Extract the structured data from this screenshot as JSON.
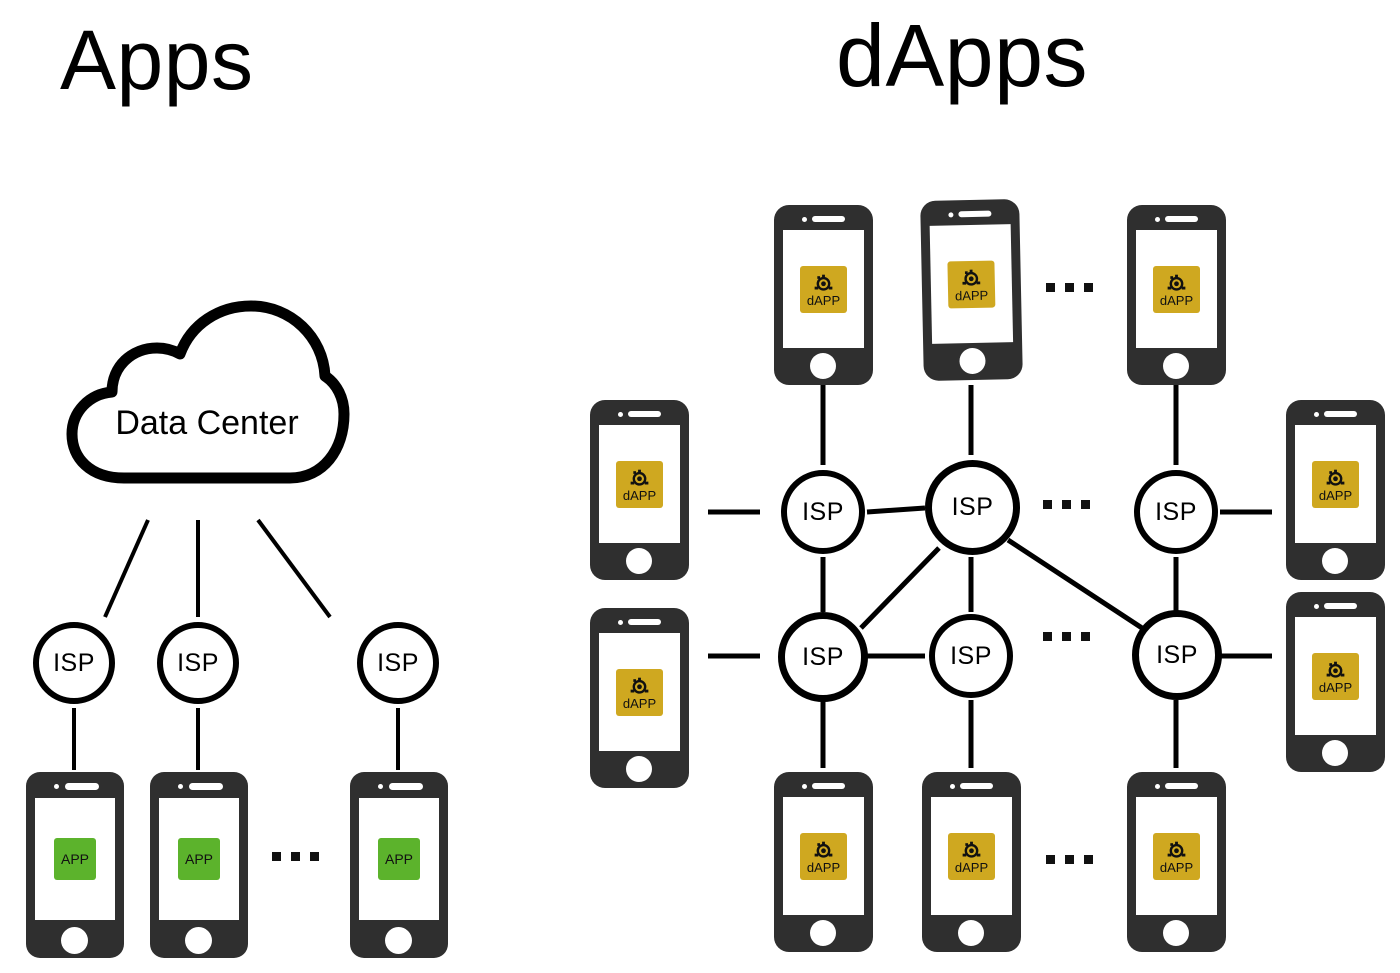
{
  "panels": {
    "apps": {
      "title": "Apps"
    },
    "dapps": {
      "title": "dApps"
    }
  },
  "labels": {
    "data_center": "Data Center",
    "isp": "ISP",
    "app": "APP",
    "dapp": "dAPP",
    "ellipsis": "..."
  },
  "colors": {
    "app_tile": "#5cb32c",
    "dapp_tile": "#cfa820",
    "phone_body": "#2f2f2f",
    "line": "#000000",
    "background": "#ffffff",
    "text": "#000000"
  },
  "icons": {
    "cloud": "cloud-icon",
    "dapp_glyph": "network-node-icon",
    "phone": "smartphone-icon"
  },
  "apps_panel": {
    "cloud": {
      "label": "Data Center"
    },
    "isps": [
      {
        "label": "ISP"
      },
      {
        "label": "ISP"
      },
      {
        "label": "ISP"
      }
    ],
    "phones": [
      {
        "tile": "APP"
      },
      {
        "tile": "APP"
      },
      {
        "tile": "APP"
      }
    ],
    "ellipses": [
      "..."
    ]
  },
  "dapps_panel": {
    "isps": [
      {
        "id": "isp-top-left",
        "label": "ISP"
      },
      {
        "id": "isp-top-center",
        "label": "ISP"
      },
      {
        "id": "isp-top-right",
        "label": "ISP"
      },
      {
        "id": "isp-bottom-left",
        "label": "ISP"
      },
      {
        "id": "isp-bottom-center",
        "label": "ISP"
      },
      {
        "id": "isp-bottom-right",
        "label": "ISP"
      }
    ],
    "phones": [
      {
        "id": "phone-top-1",
        "tile": "dAPP"
      },
      {
        "id": "phone-top-2",
        "tile": "dAPP"
      },
      {
        "id": "phone-top-3",
        "tile": "dAPP"
      },
      {
        "id": "phone-left-1",
        "tile": "dAPP"
      },
      {
        "id": "phone-left-2",
        "tile": "dAPP"
      },
      {
        "id": "phone-right-1",
        "tile": "dAPP"
      },
      {
        "id": "phone-right-2",
        "tile": "dAPP"
      },
      {
        "id": "phone-bottom-1",
        "tile": "dAPP"
      },
      {
        "id": "phone-bottom-2",
        "tile": "dAPP"
      },
      {
        "id": "phone-bottom-3",
        "tile": "dAPP"
      }
    ],
    "ellipses": [
      "...",
      "...",
      "...",
      "..."
    ]
  }
}
